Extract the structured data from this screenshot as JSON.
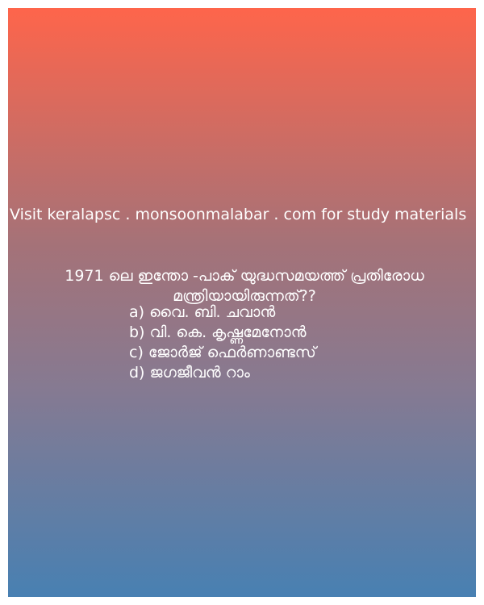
{
  "site_note": "Visit keralapsc . monsoonmalabar . com for study materials",
  "question": "1971 ലെ ഇന്തോ -പാക് യുദ്ധസമയത്ത് പ്രതിരോധ മന്ത്രിയായിരുന്നത്??",
  "options": [
    "a) വൈ. ബി. ചവാൻ",
    "b) വി. കെ. കൃഷ്ണമേനോൻ",
    "c) ജോർജ് ഫെർണാണ്ടസ്",
    "d) ജഗജീവൻ റാം"
  ],
  "colors": {
    "gradient_top": "#fe654b",
    "gradient_bottom": "#4880b2",
    "text": "#ffffff"
  }
}
